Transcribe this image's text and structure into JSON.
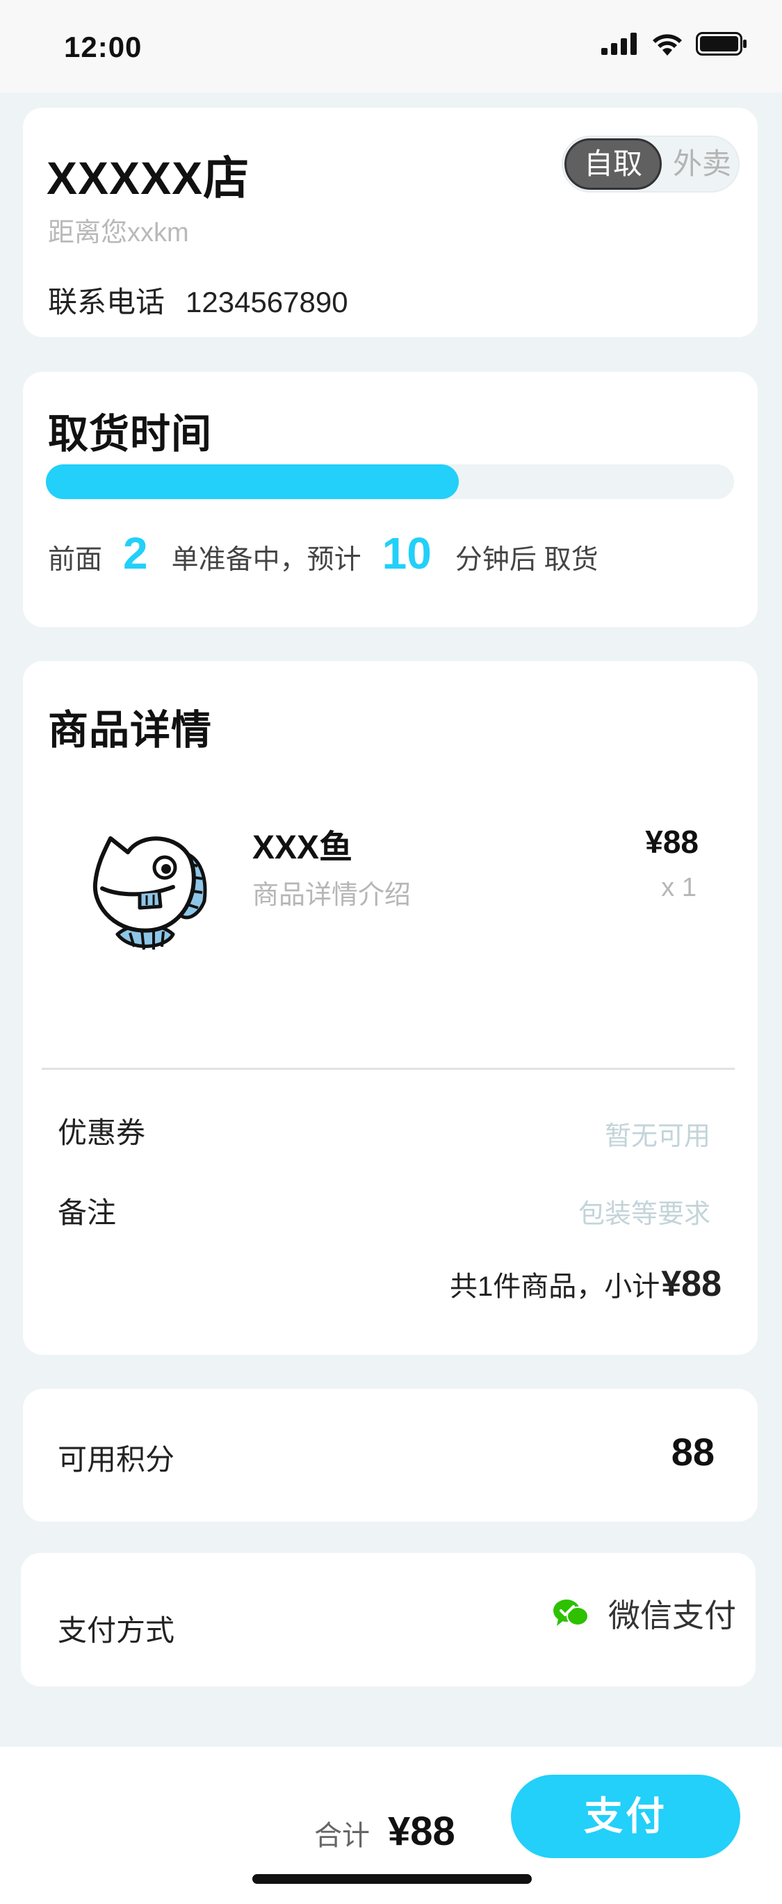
{
  "status_bar": {
    "time": "12:00"
  },
  "store": {
    "name": "XXXXX店",
    "distance": "距离您xxkm",
    "phone_label": "联系电话",
    "phone_number": "1234567890",
    "mode_options": [
      "自取",
      "外卖"
    ],
    "mode_selected": "自取"
  },
  "pickup": {
    "title": "取货时间",
    "progress_fraction": 0.6,
    "text_before": "前面",
    "orders_ahead": "2",
    "text_middle": "单准备中，预计",
    "minutes": "10",
    "text_after": "分钟后 取货"
  },
  "product_section": {
    "title": "商品详情",
    "item": {
      "image_icon": "fish-icon",
      "name": "XXX鱼",
      "description": "商品详情介绍",
      "price": "¥88",
      "quantity": "x 1"
    },
    "coupon_label": "优惠券",
    "coupon_value": "暂无可用",
    "remark_label": "备注",
    "remark_placeholder": "包装等要求",
    "subtotal_label": "共1件商品，小计",
    "subtotal_amount": "¥88"
  },
  "points": {
    "label": "可用积分",
    "value": "88"
  },
  "payment": {
    "label": "支付方式",
    "method_icon": "wechat-pay-icon",
    "method": "微信支付"
  },
  "footer": {
    "total_label": "合计",
    "total_amount": "¥88",
    "pay_button": "支付"
  },
  "colors": {
    "accent": "#22d0f9",
    "background": "#eef4f6",
    "wechat_green": "#2dc100"
  }
}
